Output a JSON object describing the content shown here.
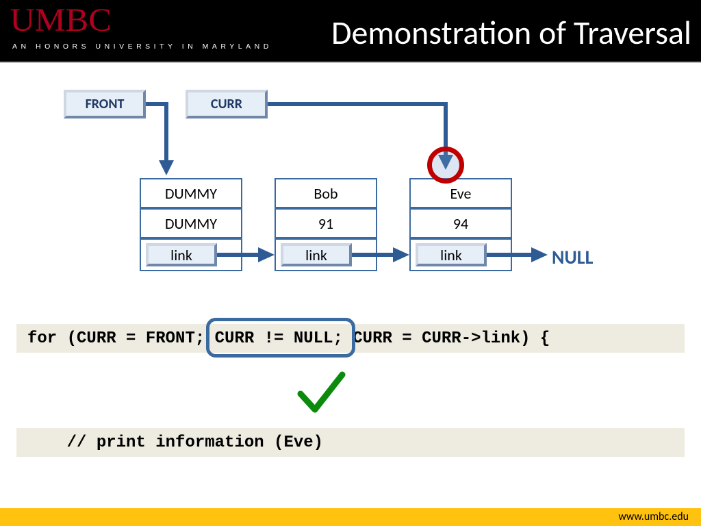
{
  "header": {
    "logo": "UMBC",
    "tagline": "AN HONORS UNIVERSITY IN MARYLAND",
    "title": "Demonstration of Traversal"
  },
  "footer": {
    "url": "www.umbc.edu"
  },
  "pointers": {
    "front": "FRONT",
    "curr": "CURR"
  },
  "nodes": [
    {
      "name": "DUMMY",
      "value": "DUMMY",
      "link": "link"
    },
    {
      "name": "Bob",
      "value": "91",
      "link": "link"
    },
    {
      "name": "Eve",
      "value": "94",
      "link": "link"
    }
  ],
  "terminal": "NULL",
  "code": {
    "line1": "for (CURR = FRONT; CURR != NULL; CURR = CURR->link) {",
    "highlighted": "CURR != NULL;",
    "line2": "    // print information (Eve)"
  },
  "highlight_target": "Eve"
}
